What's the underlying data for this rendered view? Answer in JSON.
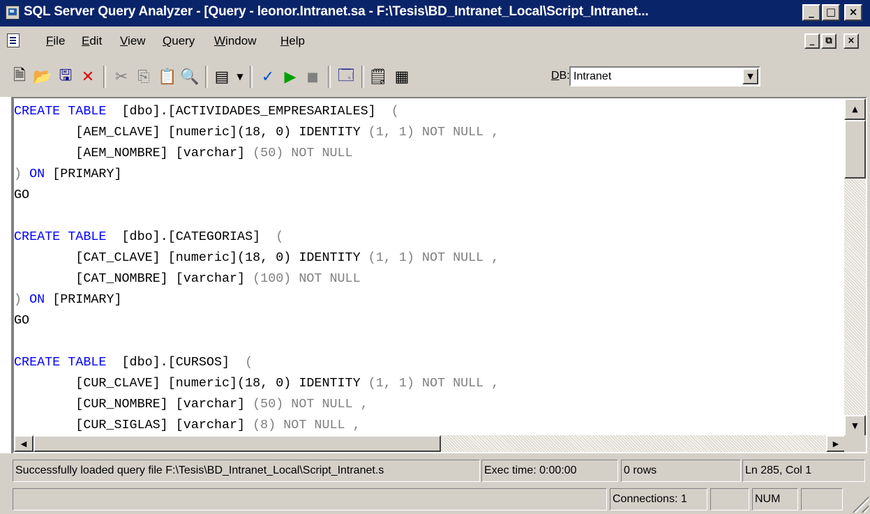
{
  "window": {
    "title": "SQL Server Query Analyzer - [Query - leonor.Intranet.sa - F:\\Tesis\\BD_Intranet_Local\\Script_Intranet...",
    "minimize": "_",
    "maximize": "□",
    "close": "×",
    "child_restore": "⧉"
  },
  "menu": {
    "items": [
      {
        "u": "F",
        "rest": "ile"
      },
      {
        "u": "E",
        "rest": "dit"
      },
      {
        "u": "V",
        "rest": "iew"
      },
      {
        "u": "Q",
        "rest": "uery"
      },
      {
        "u": "W",
        "rest": "indow"
      },
      {
        "u": "H",
        "rest": "elp"
      }
    ]
  },
  "toolbar": {
    "db_label_u": "D",
    "db_label_rest": "B:",
    "db_value": "Intranet",
    "icons": [
      "new-query-icon",
      "open-file-icon",
      "save-icon",
      "clear-icon",
      "cut-icon",
      "copy-icon",
      "paste-icon",
      "find-icon",
      "results-mode-icon",
      "parse-icon",
      "execute-icon",
      "stop-icon",
      "object-browser-icon",
      "properties-icon",
      "show-execution-plan-icon"
    ]
  },
  "editor": {
    "lines": [
      [
        [
          "kw",
          "CREATE TABLE"
        ],
        [
          "",
          "  [dbo].[ACTIVIDADES_EMPRESARIALES]  "
        ],
        [
          "nm",
          "("
        ]
      ],
      [
        [
          "",
          "        [AEM_CLAVE] [numeric](18, 0) IDENTITY "
        ],
        [
          "nm",
          "(1, 1) NOT NULL ,"
        ]
      ],
      [
        [
          "",
          "        [AEM_NOMBRE] [varchar] "
        ],
        [
          "nm",
          "(50) NOT NULL"
        ]
      ],
      [
        [
          "nm",
          ")"
        ],
        [
          "kw",
          " ON "
        ],
        [
          "",
          "[PRIMARY]"
        ]
      ],
      [
        [
          "",
          "GO"
        ]
      ],
      [
        [
          "",
          ""
        ]
      ],
      [
        [
          "kw",
          "CREATE TABLE"
        ],
        [
          "",
          "  [dbo].[CATEGORIAS]  "
        ],
        [
          "nm",
          "("
        ]
      ],
      [
        [
          "",
          "        [CAT_CLAVE] [numeric](18, 0) IDENTITY "
        ],
        [
          "nm",
          "(1, 1) NOT NULL ,"
        ]
      ],
      [
        [
          "",
          "        [CAT_NOMBRE] [varchar] "
        ],
        [
          "nm",
          "(100) NOT NULL"
        ]
      ],
      [
        [
          "nm",
          ")"
        ],
        [
          "kw",
          " ON "
        ],
        [
          "",
          "[PRIMARY]"
        ]
      ],
      [
        [
          "",
          "GO"
        ]
      ],
      [
        [
          "",
          ""
        ]
      ],
      [
        [
          "kw",
          "CREATE TABLE"
        ],
        [
          "",
          "  [dbo].[CURSOS]  "
        ],
        [
          "nm",
          "("
        ]
      ],
      [
        [
          "",
          "        [CUR_CLAVE] [numeric](18, 0) IDENTITY "
        ],
        [
          "nm",
          "(1, 1) NOT NULL ,"
        ]
      ],
      [
        [
          "",
          "        [CUR_NOMBRE] [varchar] "
        ],
        [
          "nm",
          "(50) NOT NULL ,"
        ]
      ],
      [
        [
          "",
          "        [CUR_SIGLAS] [varchar] "
        ],
        [
          "nm",
          "(8) NOT NULL ,"
        ]
      ]
    ]
  },
  "status": {
    "message": "Successfully loaded query file F:\\Tesis\\BD_Intranet_Local\\Script_Intranet.s",
    "exec_time": "Exec time: 0:00:00",
    "rows": "0 rows",
    "position": "Ln 285, Col 1",
    "connections": "Connections: 1",
    "num": "NUM"
  }
}
